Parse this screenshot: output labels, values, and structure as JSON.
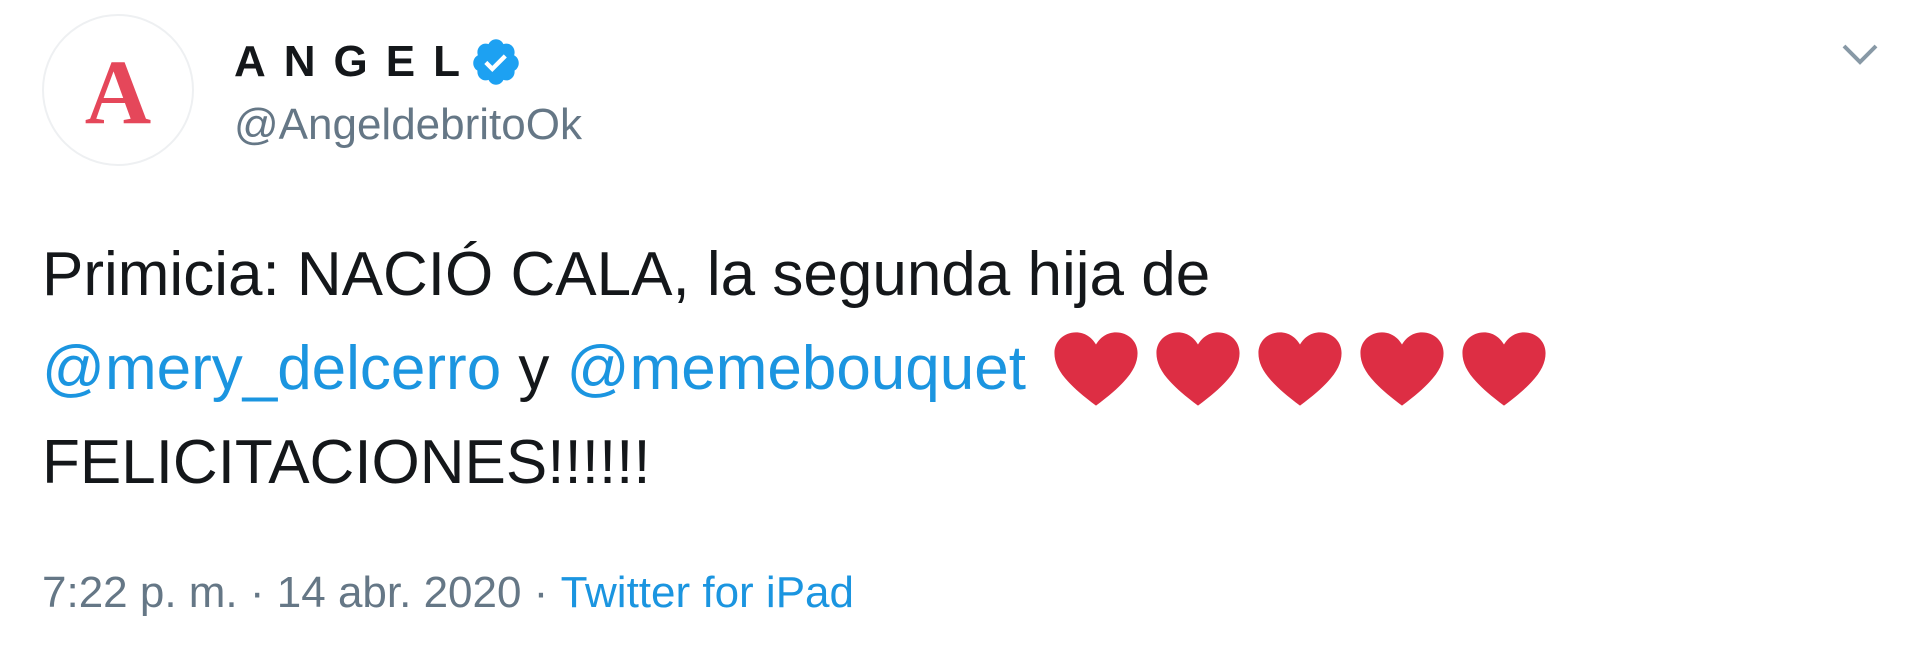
{
  "author": {
    "display_name": "ANGEL",
    "handle": "@AngeldebritoOk",
    "avatar_letter": "A",
    "avatar_color": "#e5475a",
    "verified_icon": "verified-badge-icon"
  },
  "menu_icon": "chevron-down-icon",
  "tweet": {
    "line1": "Primicia: NACIÓ CALA, la segunda hija de",
    "mention1": "@mery_delcerro",
    "connector": " y ",
    "mention2": "@memebouquet",
    "hearts_count": 5,
    "heart_color": "#dd2e44",
    "line3": "FELICITACIONES!!!!!!"
  },
  "meta": {
    "time": "7:22 p. m.",
    "sep1": " · ",
    "date": "14 abr. 2020",
    "sep2": " · ",
    "source": "Twitter for iPad"
  },
  "colors": {
    "link": "#1b95e0",
    "muted": "#657786",
    "text": "#14171a"
  }
}
